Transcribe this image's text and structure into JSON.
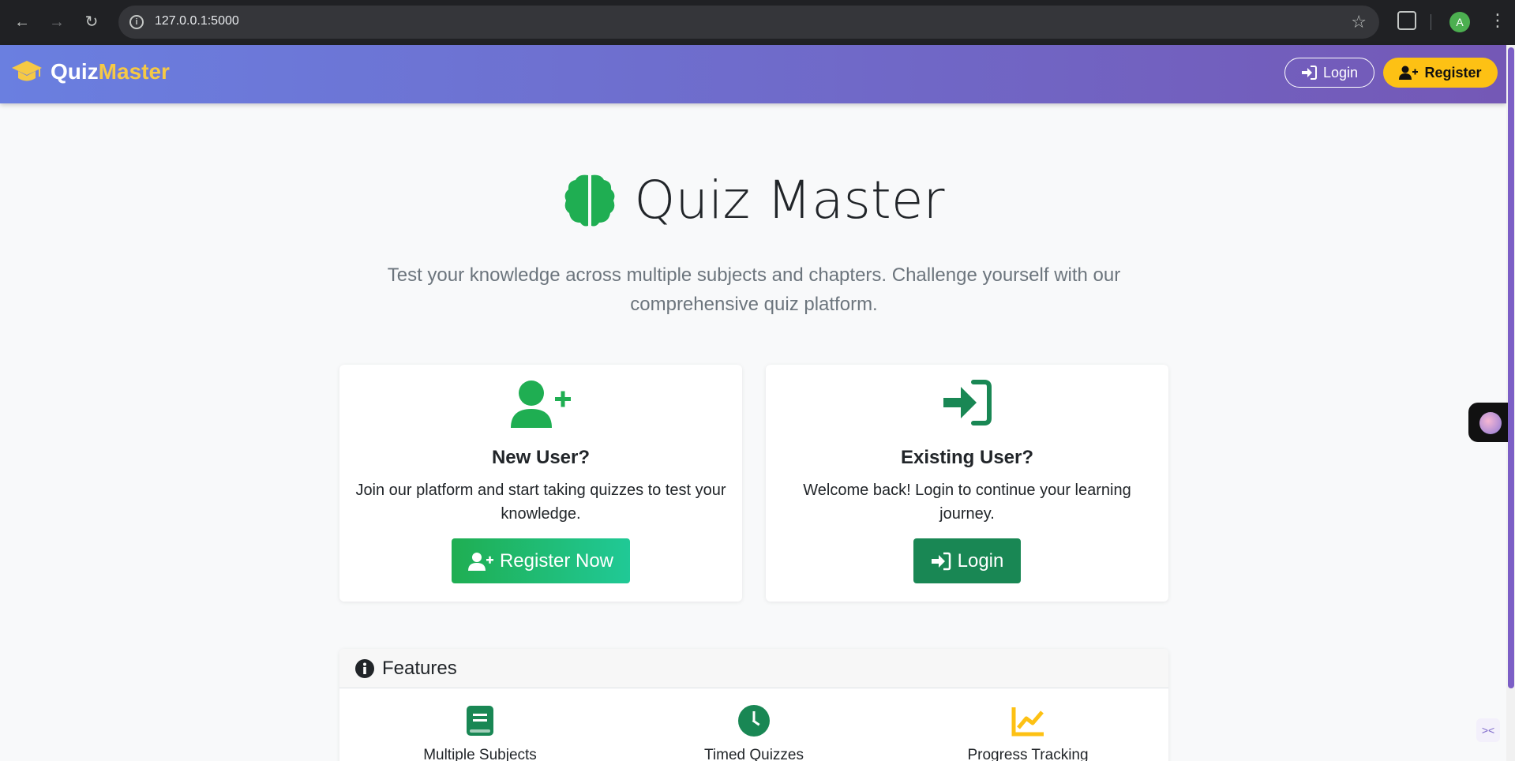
{
  "browser": {
    "url": "127.0.0.1:5000",
    "avatar_letter": "A"
  },
  "navbar": {
    "brand_quiz": "Quiz",
    "brand_master": "Master",
    "login_label": "Login",
    "register_label": "Register"
  },
  "hero": {
    "title": "Quiz Master",
    "subtitle": "Test your knowledge across multiple subjects and chapters. Challenge yourself with our comprehensive quiz platform."
  },
  "cards": {
    "new_user": {
      "title": "New User?",
      "description": "Join our platform and start taking quizzes to test your knowledge.",
      "button": "Register Now"
    },
    "existing_user": {
      "title": "Existing User?",
      "description": "Welcome back! Login to continue your learning journey.",
      "button": "Login"
    }
  },
  "features": {
    "title": "Features",
    "items": [
      {
        "label": "Multiple Subjects",
        "icon": "book-icon",
        "color": "#198754"
      },
      {
        "label": "Timed Quizzes",
        "icon": "clock-icon",
        "color": "#198754"
      },
      {
        "label": "Progress Tracking",
        "icon": "chart-line-icon",
        "color": "#fdc114"
      }
    ]
  },
  "colors": {
    "green": "#198754",
    "yellow": "#fdc114",
    "nav_gradient_start": "#6a7fe0",
    "nav_gradient_end": "#7458b6"
  }
}
